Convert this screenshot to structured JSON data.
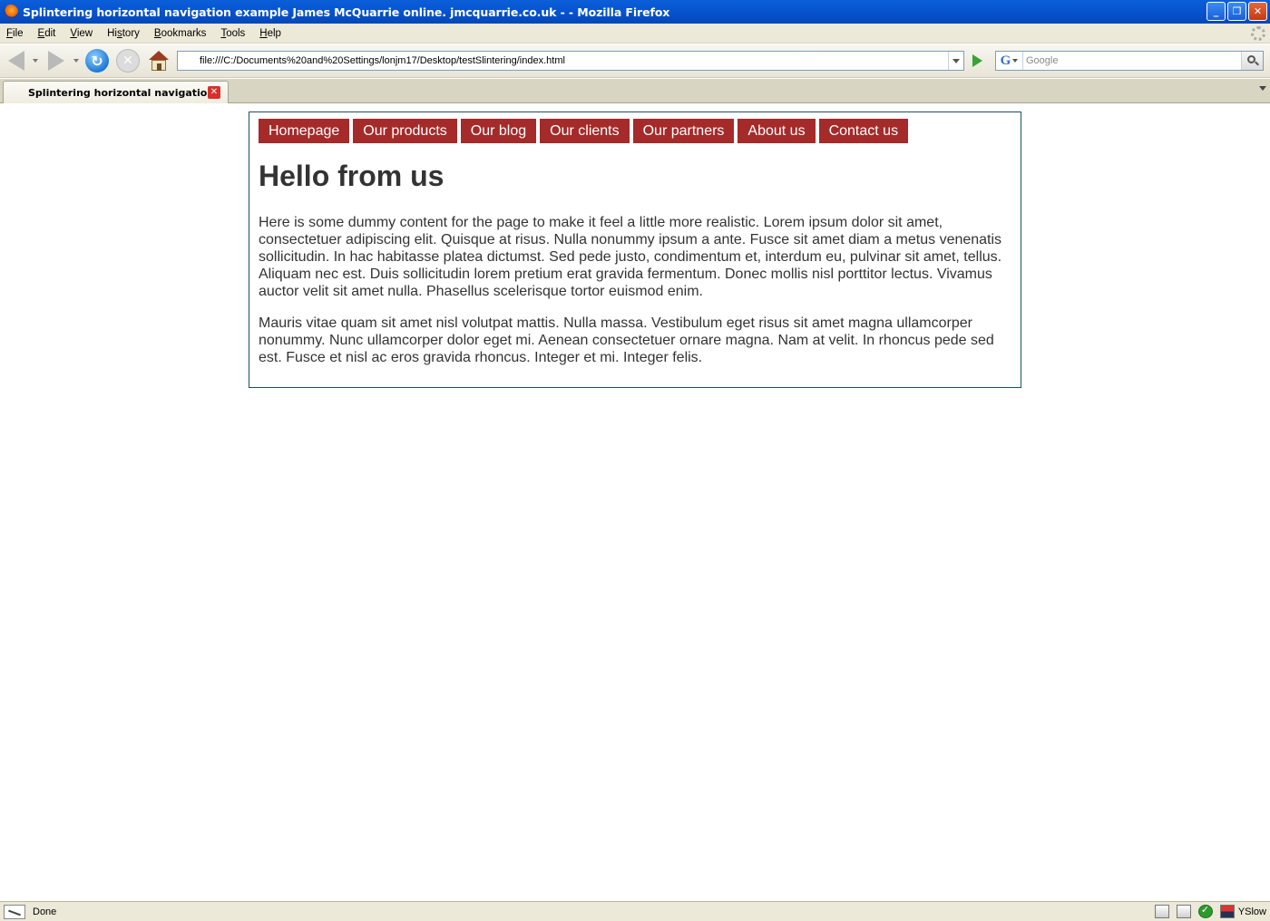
{
  "window": {
    "title": "Splintering horizontal navigation example James McQuarrie online. jmcquarrie.co.uk - - Mozilla Firefox",
    "minimize_glyph": "_",
    "restore_glyph": "❐",
    "close_glyph": "✕"
  },
  "menu": {
    "items": [
      {
        "label": "File",
        "accel": "F"
      },
      {
        "label": "Edit",
        "accel": "E"
      },
      {
        "label": "View",
        "accel": "V"
      },
      {
        "label": "History",
        "accel": "s"
      },
      {
        "label": "Bookmarks",
        "accel": "B"
      },
      {
        "label": "Tools",
        "accel": "T"
      },
      {
        "label": "Help",
        "accel": "H"
      }
    ]
  },
  "toolbar": {
    "url": "file:///C:/Documents%20and%20Settings/lonjm17/Desktop/testSlintering/index.html",
    "search_placeholder": "Google",
    "search_engine_glyph": "G",
    "reload_glyph": "↻",
    "stop_glyph": "✕"
  },
  "tabs": [
    {
      "label": "Splintering horizontal navigation ...",
      "close_glyph": "✕"
    }
  ],
  "page": {
    "nav": [
      "Homepage",
      "Our products",
      "Our blog",
      "Our clients",
      "Our partners",
      "About us",
      "Contact us"
    ],
    "heading": "Hello from us",
    "paragraphs": [
      "Here is some dummy content for the page to make it feel a little more realistic. Lorem ipsum dolor sit amet, consectetuer adipiscing elit. Quisque at risus. Nulla nonummy ipsum a ante. Fusce sit amet diam a metus venenatis sollicitudin. In hac habitasse platea dictumst. Sed pede justo, condimentum et, interdum eu, pulvinar sit amet, tellus. Aliquam nec est. Duis sollicitudin lorem pretium erat gravida fermentum. Donec mollis nisl porttitor lectus. Vivamus auctor velit sit amet nulla. Phasellus scelerisque tortor euismod enim.",
      "Mauris vitae quam sit amet nisl volutpat mattis. Nulla massa. Vestibulum eget risus sit amet magna ullamcorper nonummy. Nunc ullamcorper dolor eget mi. Aenean consectetuer ornare magna. Nam at velit. In rhoncus pede sed est. Fusce et nisl ac eros gravida rhoncus. Integer et mi. Integer felis."
    ],
    "colors": {
      "nav_bg": "#a52a2a",
      "border": "#1c4f63",
      "text": "#333333"
    }
  },
  "status": {
    "text": "Done",
    "yslow_label": "YSlow"
  }
}
